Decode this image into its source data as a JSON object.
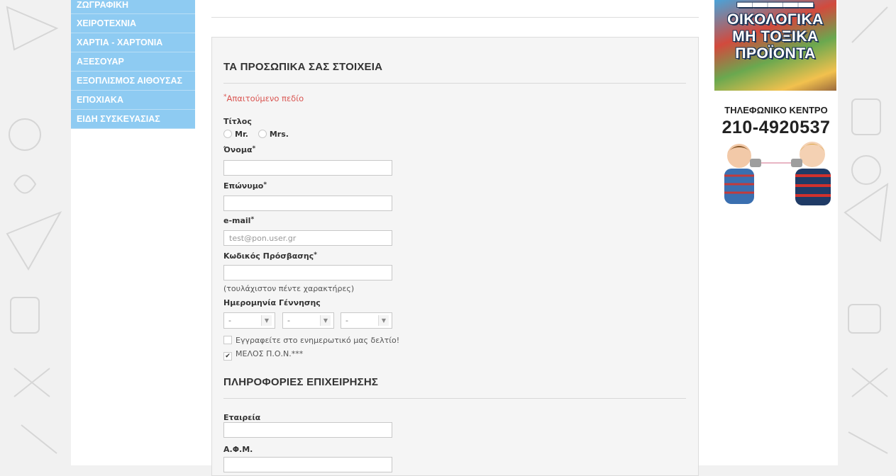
{
  "sidebar": {
    "items": [
      {
        "label": "ΖΩΓΡΑΦΙΚΗ"
      },
      {
        "label": "ΧΕΙΡΟΤΕΧΝΙΑ"
      },
      {
        "label": "ΧΑΡΤΙΑ - ΧΑΡΤΟΝΙΑ"
      },
      {
        "label": "ΑΞΕΣΟΥΑΡ"
      },
      {
        "label": "ΕΞΟΠΛΙΣΜΟΣ ΑΙΘΟΥΣΑΣ"
      },
      {
        "label": "ΕΠΟΧΙΑΚΑ"
      },
      {
        "label": "ΕΙΔΗ ΣΥΣΚΕΥΑΣΙΑΣ"
      }
    ]
  },
  "form": {
    "personal_title": "ΤΑ ΠΡΟΣΩΠΙΚΑ ΣΑΣ ΣΤΟΙΧΕΙΑ",
    "required_star": "*",
    "required_note": "Απαιτούμενο πεδίο",
    "title_label": "Τίτλος",
    "title_options": [
      "Mr.",
      "Mrs."
    ],
    "first_name_label": "Όνομα",
    "last_name_label": "Επώνυμο",
    "email_label": "e-mail",
    "email_placeholder": "test@pon.user.gr",
    "password_label": "Κωδικός Πρόσβασης",
    "password_hint": "(τουλάχιστον πέντε χαρακτήρες)",
    "birthdate_label": "Ημερομηνία Γέννησης",
    "birthdate_day": "-",
    "birthdate_month": "-",
    "birthdate_year": "-",
    "newsletter_label": "Εγγραφείτε στο ενημερωτικό μας δελτίο!",
    "newsletter_checked": false,
    "member_label": "ΜΕΛΟΣ Π.Ο.Ν.***",
    "member_checked": true,
    "business_title": "ΠΛΗΡΟΦΟΡΙΕΣ ΕΠΙΧΕΙΡΗΣΗΣ",
    "company_label": "Εταιρεία",
    "vat_label": "Α.Φ.Μ."
  },
  "right_column": {
    "promo_lines": [
      "ΟΙΚΟΛΟΓΙΚΑ",
      "ΜΗ ΤΟΞΙΚΑ",
      "ΠΡΟΪΟΝΤΑ"
    ],
    "phone_label": "ΤΗΛΕΦΩΝΙΚΟ ΚΕΝΤΡΟ",
    "phone_number": "210-4920537"
  },
  "colors": {
    "sidebar_bg": "#8ecbf2",
    "required": "#d9534f",
    "page_bg": "#f1f1f1"
  }
}
